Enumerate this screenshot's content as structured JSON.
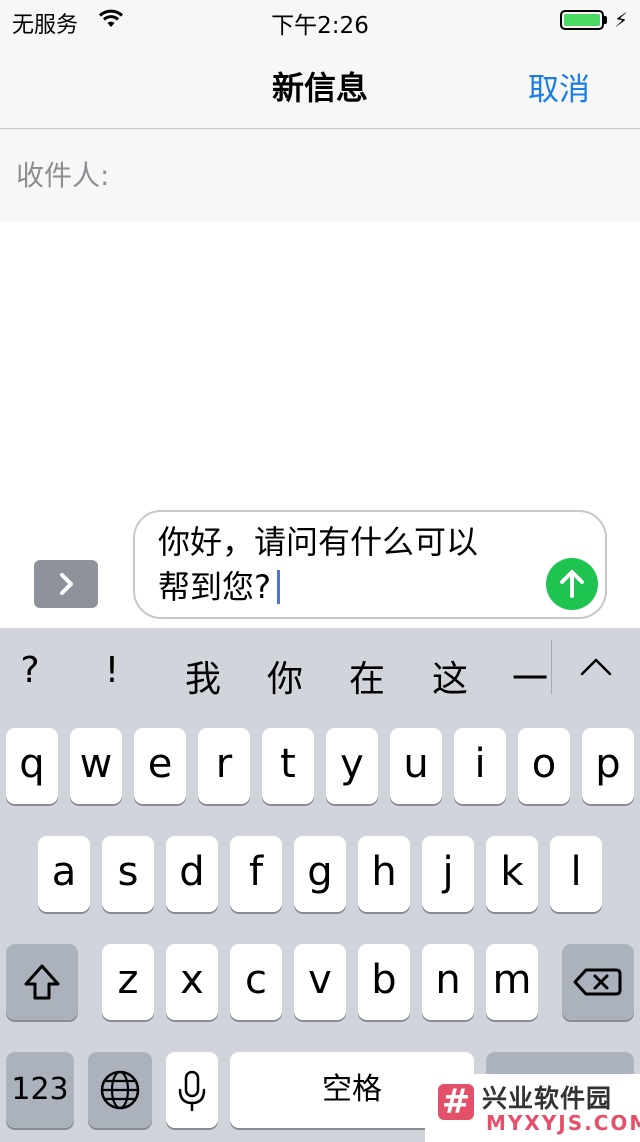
{
  "status_bar": {
    "carrier": "无服务",
    "time": "下午2:26",
    "battery_level": 1.0,
    "battery_color": "#4cd964"
  },
  "nav": {
    "title": "新信息",
    "cancel": "取消",
    "accent_color": "#1a7ee6"
  },
  "recipient": {
    "label": "收件人:"
  },
  "compose": {
    "line1": "你好，请问有什么可以",
    "line2": "帮到您?",
    "send_icon": "arrow-up-icon",
    "expand_icon": "chevron-right-icon",
    "send_color": "#1fc34f"
  },
  "keyboard": {
    "candidates": [
      "?",
      "!",
      "我",
      "你",
      "在",
      "这",
      "一"
    ],
    "collapse_icon": "chevron-up-icon",
    "row1": [
      "q",
      "w",
      "e",
      "r",
      "t",
      "y",
      "u",
      "i",
      "o",
      "p"
    ],
    "row2": [
      "a",
      "s",
      "d",
      "f",
      "g",
      "h",
      "j",
      "k",
      "l"
    ],
    "row3": [
      "z",
      "x",
      "c",
      "v",
      "b",
      "n",
      "m"
    ],
    "numbers_key": "123",
    "space_key": "空格",
    "shift_icon": "shift-icon",
    "delete_icon": "backspace-icon",
    "globe_icon": "globe-icon",
    "mic_icon": "microphone-icon"
  },
  "watermark": {
    "title": "兴业软件园",
    "subtitle": "MYXYJS.COM",
    "mark": "#"
  }
}
